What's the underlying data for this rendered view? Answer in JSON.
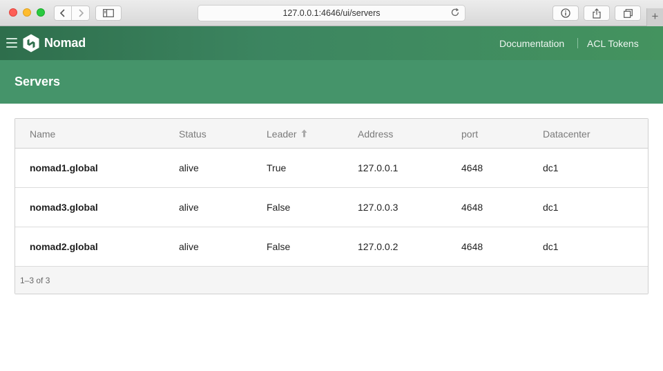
{
  "browser": {
    "url": "127.0.0.1:4646/ui/servers",
    "icons": [
      "back-icon",
      "forward-icon",
      "sidebar-icon",
      "reload-icon",
      "info-icon",
      "share-icon",
      "tabs-icon",
      "new-tab-icon"
    ]
  },
  "header": {
    "brand": "Nomad",
    "links": [
      "Documentation",
      "ACL Tokens"
    ]
  },
  "page": {
    "title": "Servers"
  },
  "table": {
    "columns": [
      "Name",
      "Status",
      "Leader",
      "Address",
      "port",
      "Datacenter"
    ],
    "sorted_column": "Leader",
    "rows": [
      {
        "name": "nomad1.global",
        "status": "alive",
        "leader": "True",
        "address": "127.0.0.1",
        "port": "4648",
        "datacenter": "dc1"
      },
      {
        "name": "nomad3.global",
        "status": "alive",
        "leader": "False",
        "address": "127.0.0.3",
        "port": "4648",
        "datacenter": "dc1"
      },
      {
        "name": "nomad2.global",
        "status": "alive",
        "leader": "False",
        "address": "127.0.0.2",
        "port": "4648",
        "datacenter": "dc1"
      }
    ],
    "footer": "1–3 of 3"
  },
  "colors": {
    "brand_green": "#45946a",
    "header_dark": "#2e6e4c"
  }
}
